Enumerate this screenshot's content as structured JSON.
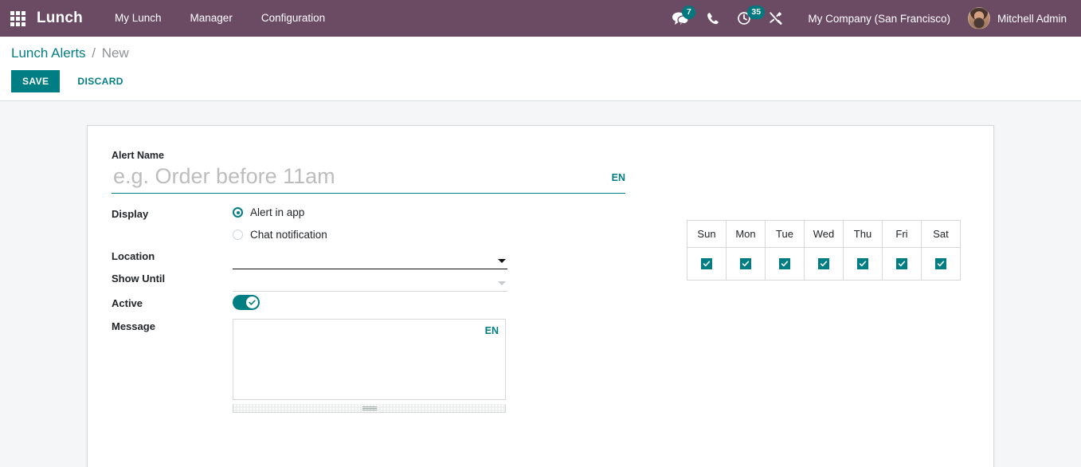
{
  "navbar": {
    "apps_icon": "apps-grid-icon",
    "brand": "Lunch",
    "menus": [
      {
        "label": "My Lunch"
      },
      {
        "label": "Manager"
      },
      {
        "label": "Configuration"
      }
    ],
    "messages_icon": "messages-icon",
    "messages_count": "7",
    "phone_icon": "phone-icon",
    "activities_icon": "activities-clock-icon",
    "activities_count": "35",
    "tools_icon": "tools-icon",
    "company": "My Company (San Francisco)",
    "avatar": "user-avatar",
    "user": "Mitchell Admin",
    "accent": "#00787f",
    "background": "#6b4a64"
  },
  "control_panel": {
    "breadcrumb_root": "Lunch Alerts",
    "breadcrumb_separator": "/",
    "breadcrumb_current": "New",
    "save_label": "SAVE",
    "discard_label": "DISCARD",
    "accent": "#017e84"
  },
  "form": {
    "alert_name": {
      "label": "Alert Name",
      "value": "",
      "placeholder": "e.g. Order before 11am",
      "lang": "EN"
    },
    "display": {
      "label": "Display",
      "options": [
        {
          "label": "Alert in app",
          "checked": true
        },
        {
          "label": "Chat notification",
          "checked": false
        }
      ]
    },
    "location": {
      "label": "Location",
      "value": "",
      "placeholder": ""
    },
    "show_until": {
      "label": "Show Until",
      "value": "",
      "placeholder": ""
    },
    "active": {
      "label": "Active",
      "checked": true,
      "toggle_icon": "check-icon"
    },
    "message": {
      "label": "Message",
      "value": "",
      "placeholder": "",
      "lang": "EN",
      "resize_handle": "resize-handle-icon"
    }
  },
  "days": {
    "headers": [
      "Sun",
      "Mon",
      "Tue",
      "Wed",
      "Thu",
      "Fri",
      "Sat"
    ],
    "checked": [
      true,
      true,
      true,
      true,
      true,
      true,
      true
    ],
    "check_icon": "check-icon",
    "accent": "#017e84"
  }
}
